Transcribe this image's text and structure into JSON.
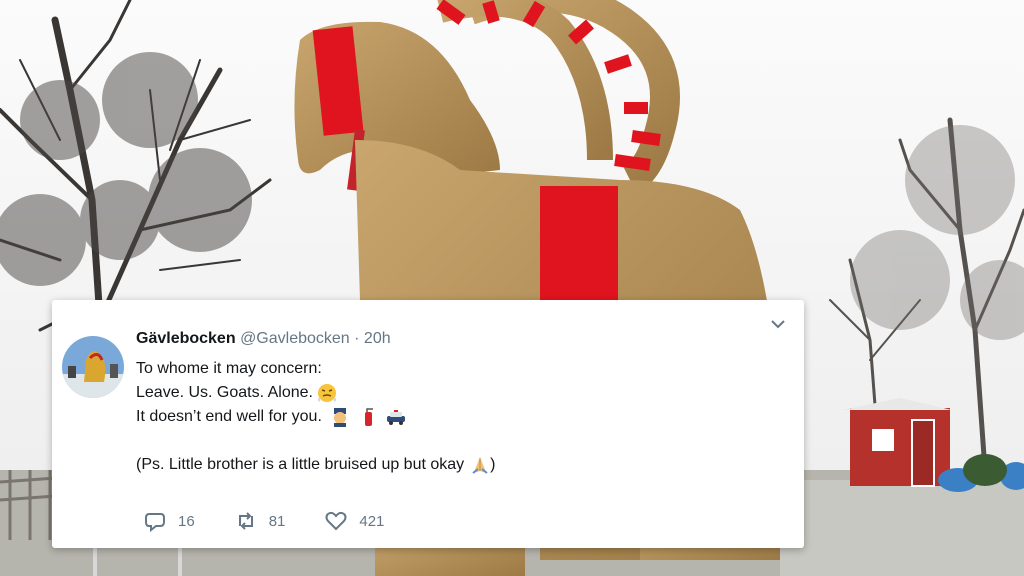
{
  "tweet": {
    "display_name": "Gävlebocken",
    "handle_time": "@Gavlebocken · 20h",
    "lines": [
      "To whome it may concern:",
      "Leave. Us. Goats. Alone.",
      "It doesn’t end well for you.",
      "(Ps. Little brother is a little bruised up but okay"
    ],
    "closing_paren": ")",
    "replies": "16",
    "retweets": "81",
    "likes": "421"
  },
  "icons": {
    "caret": "chevron-down-icon",
    "reply": "reply-icon",
    "retweet": "retweet-icon",
    "like": "heart-icon",
    "emojis": [
      "face-with-steam-emoji",
      "police-officer-emoji",
      "fire-extinguisher-emoji",
      "police-car-emoji",
      "folded-hands-emoji"
    ]
  },
  "colors": {
    "accent_red": "#e0141e",
    "straw": "#b8925a",
    "text": "#14171a",
    "muted": "#657786"
  }
}
